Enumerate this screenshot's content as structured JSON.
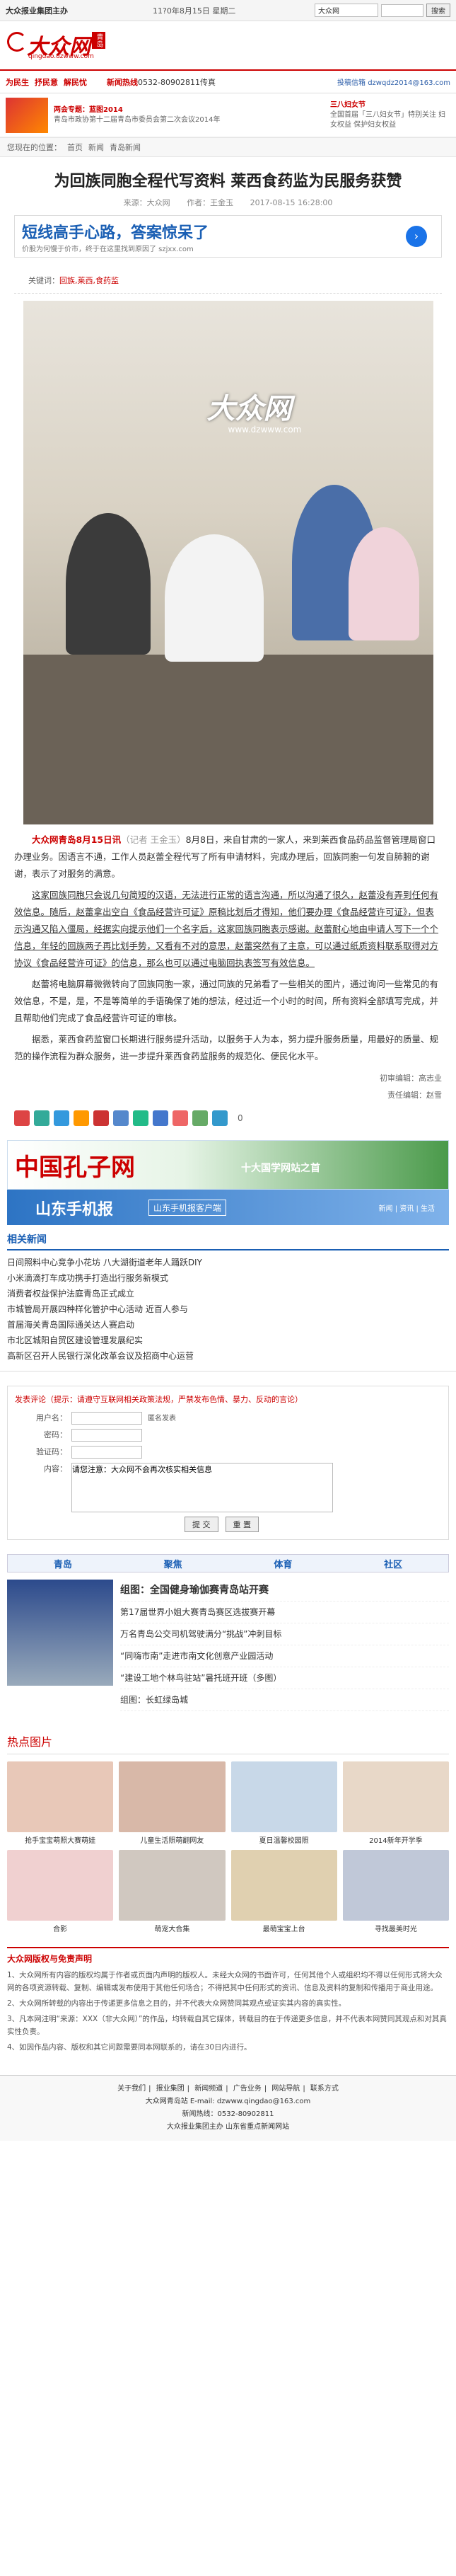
{
  "topbar": {
    "brand": "大众报业集团主办",
    "date": "11?0年8月15日 星期二",
    "select_label": "大众网",
    "search_button": "搜索"
  },
  "header": {
    "logo_text": "大众网",
    "logo_sub": "qingdao.dzwww.com",
    "logo_tag": "青岛"
  },
  "nav": {
    "links": [
      "为民生",
      "抒民意",
      "解民忧"
    ],
    "hotline_prefix": "新闻热线",
    "hotline": "0532-80902811传真",
    "mail": "投稿信箱 dzwqdz2014@163.com"
  },
  "promo": {
    "left_title": "两会专题：蓝图2014",
    "left_text": "青岛市政协第十二届青岛市委员会第二次会议2014年",
    "right_title": "三八妇女节",
    "right_text": "全国首届「三八妇女节」特别关注 妇女权益 保护妇女权益"
  },
  "breadcrumb": [
    "您现在的位置：",
    "首页",
    "新闻",
    "青岛新闻"
  ],
  "article": {
    "title": "为回族同胞全程代写资料 莱西食药监为民服务获赞",
    "source": "来源：大众网",
    "author": "作者：王金玉",
    "time": "2017-08-15 16:28:00",
    "keywords_label": "关键词：",
    "keywords": "回族,莱西,食药监",
    "photo_watermark": "大众网",
    "photo_watermark_sub": "www.dzwww.com",
    "paragraphs": [
      {
        "lead": "大众网青岛8月15日讯",
        "grey": "（记者 王金玉）",
        "text": "8月8日，来自甘肃的一家人，来到莱西食品药品监督管理局窗口办理业务。因语言不通，工作人员赵蕾全程代写了所有申请材料，完成办理后，回族同胞一句发自肺腑的谢谢，表示了对服务的满意。"
      },
      {
        "text": "这家回族同胞只会说几句简短的汉语，无法进行正常的语言沟通，所以沟通了很久，赵蕾没有弄到任何有效信息。随后，赵蕾拿出空白《食品经营许可证》原稿比划后才得知，他们要办理《食品经营许可证》，但表示沟通又陷入僵局，经据实向提示他们一个名字后，这家回族同胞表示感谢。赵蕾耐心地由申请人写下一个个信息，年轻的回族两子再比划手势，又看有不对的意思，赵蕾突然有了主意，可以通过纸质资料联系取得对方协议《食品经营许可证》的信息，那么也可以通过电脑回执表签写有效信息。"
      },
      {
        "text": "赵蕾将电脑屏幕微微转向了回族同胞一家，通过同族的兄弟看了一些相关的图片，通过询问一些常见的有效信息，不是，是，不是等简单的手语确保了她的想法，经过近一个小时的时间，所有资料全部填写完成，并且帮助他们完成了食品经营许可证的审核。"
      },
      {
        "text": "据悉，莱西食药监窗口长期进行服务提升活动，以服务于人为本，努力提升服务质量，用最好的质量、规范的操作流程为群众服务，进一步提升莱西食药监服务的规范化、便民化水平。"
      }
    ],
    "editor": "初审编辑：高志业",
    "editor2": "责任编辑：赵雪"
  },
  "share": {
    "count": "0"
  },
  "banners": {
    "kongzi": "中国孔子网",
    "kongzi_sub": "十大国学网站之首",
    "phone": "山东手机报",
    "phone_sub": "山东手机报客户端",
    "phone_right": "新闻 | 资讯 | 生活"
  },
  "related": {
    "title": "相关新闻",
    "items": [
      "日间照料中心竞争小花坊 八大湖街道老年人踊跃DIY",
      "小米滴滴打车成功携手打造出行服务新模式",
      "消费者权益保护法庭青岛正式成立",
      "市城管局开展四种样化管护中心活动 近百人参与",
      "首届海关青岛国际通关达人赛启动",
      "市北区城阳自贸区建设管理发展纪实",
      "高新区召开人民银行深化改革会议及招商中心运营"
    ]
  },
  "comment": {
    "header": "发表评论（提示：请遵守互联网相关政策法规，严禁发布色情、暴力、反动的言论）",
    "user_label": "用户名：",
    "user_checkbox": "匿名发表",
    "pass_label": "密码：",
    "verify_label": "验证码：",
    "content_label": "内容：",
    "content_value": "请您注意：大众网不会再次核实相关信息",
    "submit": "提 交",
    "reset": "重 置"
  },
  "tabs": [
    "青岛",
    "聚焦",
    "体育",
    "社区"
  ],
  "news": {
    "items": [
      "组图：全国健身瑜伽赛青岛站开赛",
      "第17届世界小姐大赛青岛赛区选拔赛开幕",
      "万名青岛公交司机驾驶满分“挑战”冲刺目标",
      "“同嗨市南”走进市南文化创意产业园活动",
      "“建设工地个林鸟驻站”暑托班开班（多图）",
      "组图：长虹绿岛城"
    ]
  },
  "hotpics": {
    "title": "热点图片",
    "items": [
      "抢手宝宝萌照大赛萌娃",
      "儿童生活照萌翻网友",
      "夏日温馨校园照",
      "2014新年开学季",
      "合影",
      "萌宠大合集",
      "最萌宝宝上台",
      "寻找最美时光"
    ]
  },
  "declare": {
    "title": "大众网版权与免责声明",
    "lines": [
      "1、大众网所有内容的版权均属于作者或页面内声明的版权人。未经大众网的书面许可，任何其他个人或组织均不得以任何形式将大众网的各项资源转载、复制、编辑或发布使用于其他任何场合；不得把其中任何形式的资讯、信息及资料的复制和传播用于商业用途。",
      "2、大众网所转载的内容出于传递更多信息之目的，并不代表大众网赞同其观点或证实其内容的真实性。",
      "3、凡本网注明“来源：XXX（非大众网）”的作品，均转载自其它媒体，转载目的在于传递更多信息，并不代表本网赞同其观点和对其真实性负责。",
      "4、如因作品内容、版权和其它问题需要同本网联系的，请在30日内进行。"
    ]
  },
  "footer": {
    "links": [
      "关于我们",
      "报业集团",
      "新闻频道",
      "广告业务",
      "网站导航",
      "联系方式"
    ],
    "company": "大众网青岛站 E-mail: dzwww.qingdao@163.com",
    "phone": "新闻热线：0532-80902811",
    "copy": "大众报业集团主办 山东省重点新闻网站"
  }
}
